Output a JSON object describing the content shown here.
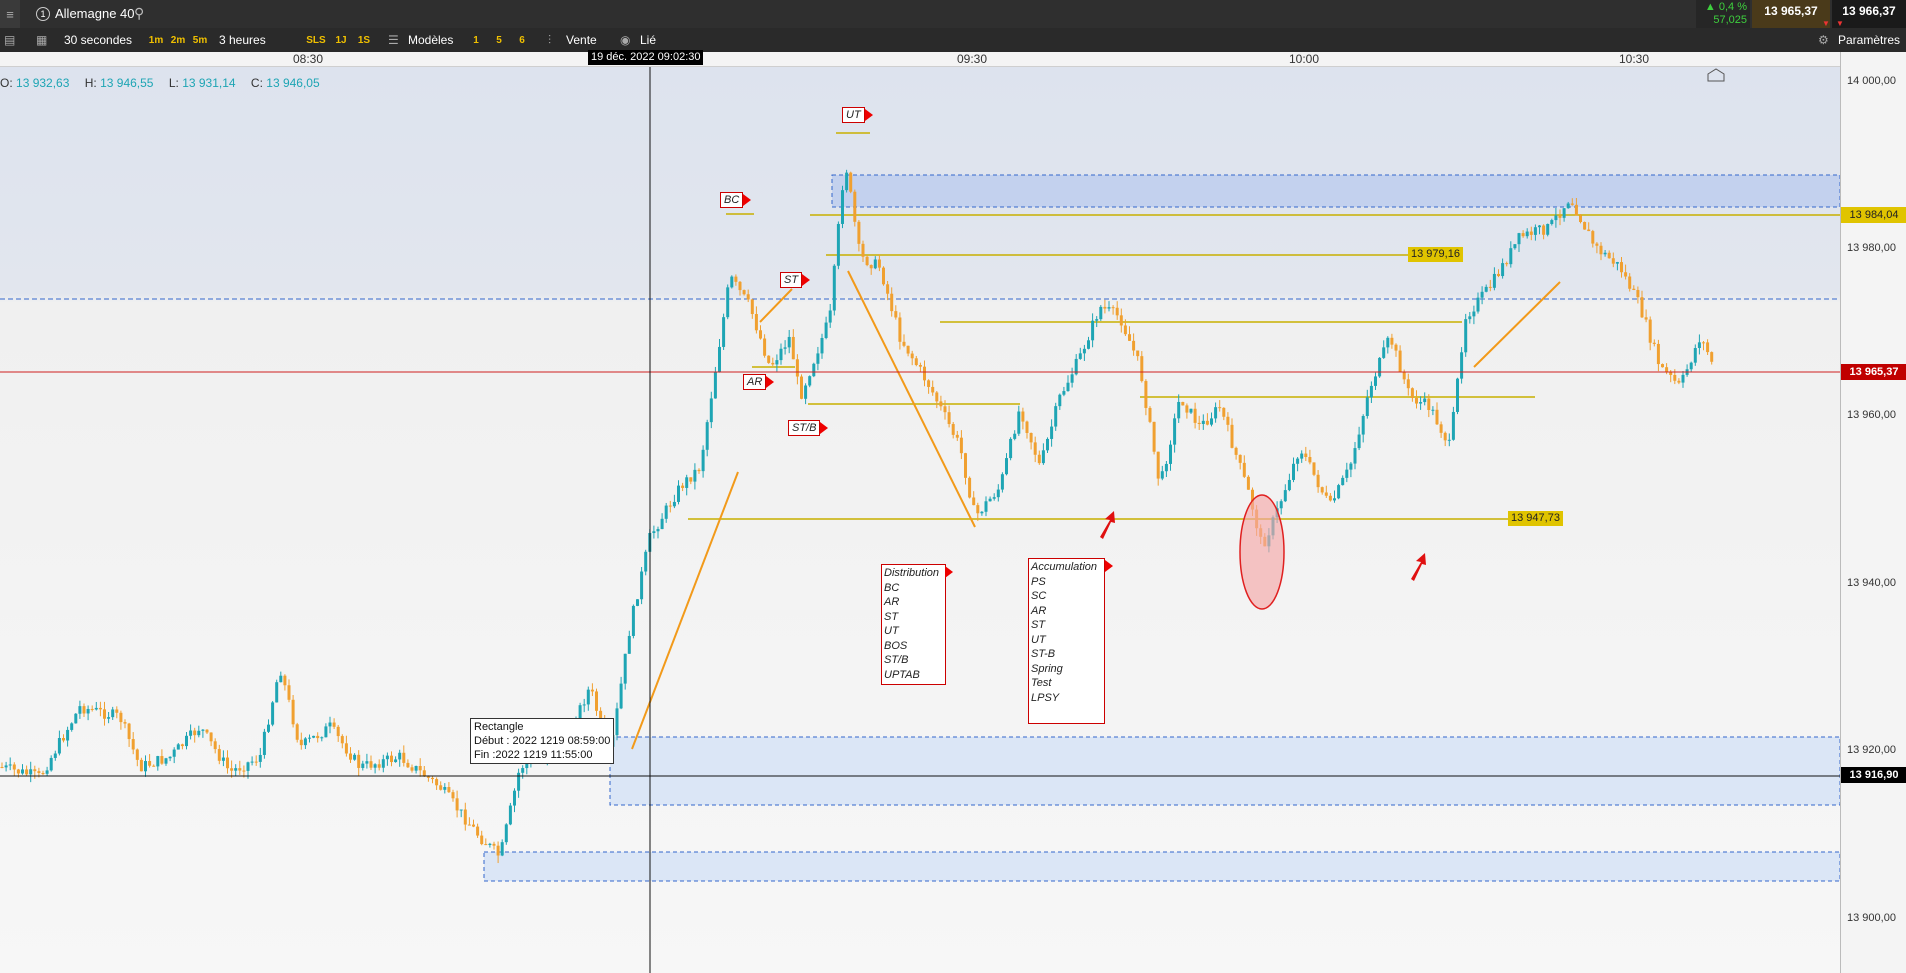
{
  "topbar": {
    "menu_icon": "hamburger-icon",
    "instrument_number": "1",
    "instrument": "Allemagne 40",
    "search_icon": "search-icon",
    "change_pct": "▲ 0,4 %",
    "change_abs": "57,025",
    "bid": "13 965,37",
    "ask": "13 966,37"
  },
  "toolbar": {
    "timeframe": "30 secondes",
    "tf_1m": "1m",
    "tf_2m": "2m",
    "tf_5m": "5m",
    "period": "3 heures",
    "sls": "SLS",
    "d1": "1J",
    "s1": "1S",
    "templates": "Modèles",
    "n1": "1",
    "n5": "5",
    "n6": "6",
    "sell": "Vente",
    "linked": "Lié",
    "settings": "Paramètres"
  },
  "time_axis": {
    "labels": [
      "08:30",
      "09:30",
      "10:00",
      "10:30"
    ],
    "crosshair": "19 déc. 2022 09:02:30"
  },
  "ohlc": {
    "o_label": "O:",
    "o": "13 932,63",
    "h_label": "H:",
    "h": "13 946,55",
    "l_label": "L:",
    "l": "13 931,14",
    "c_label": "C:",
    "c": "13 946,05"
  },
  "price_axis": {
    "labels": [
      "14 000,00",
      "13 980,00",
      "13 960,00",
      "13 940,00",
      "13 920,00",
      "13 900,00"
    ],
    "level_upper": "13 984,04",
    "current": "13 965,37",
    "crosshair": "13 916,90"
  },
  "level_labels": {
    "l1": "13 979,16",
    "l2": "13 947,73"
  },
  "tags": {
    "bc": "BC",
    "ut": "UT",
    "st": "ST",
    "ar": "AR",
    "stb": "ST/B"
  },
  "distribution": {
    "title": "Distribution",
    "items": [
      "BC",
      "AR",
      "ST",
      "UT",
      "BOS",
      "ST/B",
      "UPTAB"
    ]
  },
  "accumulation": {
    "title": "Accumulation",
    "items": [
      "PS",
      "SC",
      "AR",
      "ST",
      "UT",
      "ST-B",
      "Spring",
      "Test",
      "LPSY"
    ]
  },
  "rectangle_info": {
    "title": "Rectangle",
    "start": "Début : 2022 1219 08:59:00",
    "end": "Fin :2022 1219 11:55:00"
  },
  "colors": {
    "up": "#1ea5b4",
    "down": "#f0a030",
    "level": "#c8b000",
    "current": "#c00000"
  }
}
